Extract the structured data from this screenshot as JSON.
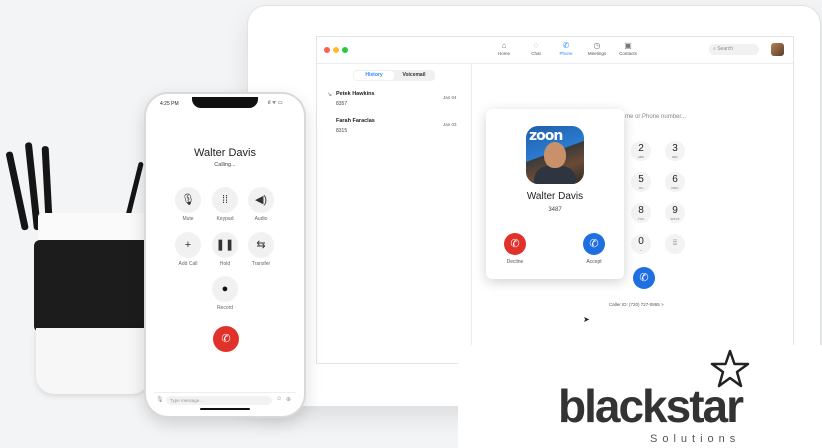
{
  "phone_app": {
    "status_time": "4:25 PM",
    "caller_name": "Walter Davis",
    "call_status": "Calling...",
    "controls": [
      {
        "label": "Mute",
        "icon": "microphone-icon"
      },
      {
        "label": "Keypad",
        "icon": "keypad-icon"
      },
      {
        "label": "Audio",
        "icon": "speaker-icon"
      },
      {
        "label": "Add Call",
        "icon": "plus-icon"
      },
      {
        "label": "Hold",
        "icon": "pause-icon"
      },
      {
        "label": "Transfer",
        "icon": "transfer-icon"
      },
      {
        "label": "Record",
        "icon": "record-icon"
      }
    ],
    "message_placeholder": "Type message..."
  },
  "desktop_app": {
    "nav": [
      {
        "label": "Home",
        "icon": "home-icon"
      },
      {
        "label": "Chat",
        "icon": "chat-icon"
      },
      {
        "label": "Phone",
        "icon": "phone-icon",
        "active": true
      },
      {
        "label": "Meetings",
        "icon": "clock-icon"
      },
      {
        "label": "Contacts",
        "icon": "contacts-icon"
      }
    ],
    "search_placeholder": "Search",
    "tabs": {
      "history": "History",
      "voicemail": "Voicemail"
    },
    "history": [
      {
        "name": "Petek Hawkins",
        "number": "8357",
        "date": "Jan 04"
      },
      {
        "name": "Farah Faraclas",
        "number": "8315",
        "date": "Jan 03"
      }
    ],
    "number_input_placeholder": "me or Phone number...",
    "dialpad": [
      {
        "digit": "2",
        "letters": "ABC"
      },
      {
        "digit": "3",
        "letters": "DEF"
      },
      {
        "digit": "5",
        "letters": "JKL"
      },
      {
        "digit": "6",
        "letters": "MNO"
      },
      {
        "digit": "8",
        "letters": "TUV"
      },
      {
        "digit": "9",
        "letters": "WXYZ"
      },
      {
        "digit": "0",
        "letters": "+"
      }
    ],
    "caller_id": "Caller ID: (720) 727-0865 >",
    "incoming_call": {
      "name": "Walter Davis",
      "number": "3487",
      "photo_text": "zoon",
      "decline_label": "Decline",
      "accept_label": "Accept"
    }
  },
  "logo": {
    "name": "blackstar",
    "tagline": "Solutions"
  },
  "colors": {
    "accent_blue": "#1f6fe0",
    "decline_red": "#e0322a",
    "window_dot_red": "#ff5f57",
    "window_dot_yellow": "#febc2e",
    "window_dot_green": "#28c840"
  }
}
